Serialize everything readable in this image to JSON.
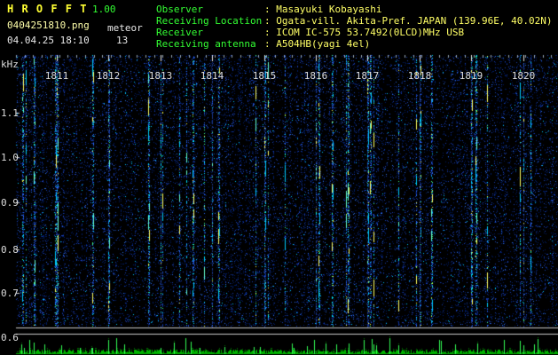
{
  "header": {
    "app_title": "H R O F F T",
    "version": "1.00",
    "filename": "0404251810.png",
    "datetime": "04.04.25 18:10",
    "meteor_label": "meteor",
    "meteor_count": "13"
  },
  "info": {
    "rows": [
      {
        "label": "Observer",
        "sep": ":",
        "value": "Masayuki Kobayashi"
      },
      {
        "label": "Receiving Location",
        "sep": ":",
        "value": "Ogata-vill. Akita-Pref. JAPAN (139.96E, 40.02N)"
      },
      {
        "label": "Receiver",
        "sep": ":",
        "value": "ICOM IC-575 53.7492(0LCD)MHz USB"
      },
      {
        "label": "Receiving antenna",
        "sep": ":",
        "value": "A504HB(yagi 4el)"
      }
    ]
  },
  "spectrogram": {
    "freq_unit": "kHz",
    "freq_ticks": [
      "1.1",
      "1.0",
      "0.9",
      "0.8",
      "0.7",
      "0.6"
    ],
    "time_labels": [
      "1811",
      "1812",
      "1813",
      "1814",
      "1815",
      "1816",
      "1817",
      "1818",
      "1819",
      "1820"
    ]
  },
  "colors": {
    "background": "#000000",
    "title": "#ffff33",
    "version": "#33ff33",
    "filename": "#ffffaa",
    "text": "#e8e8e8",
    "label_green": "#33ff33",
    "value_yellow": "#ffff66",
    "axis_text": "#dddddd"
  }
}
